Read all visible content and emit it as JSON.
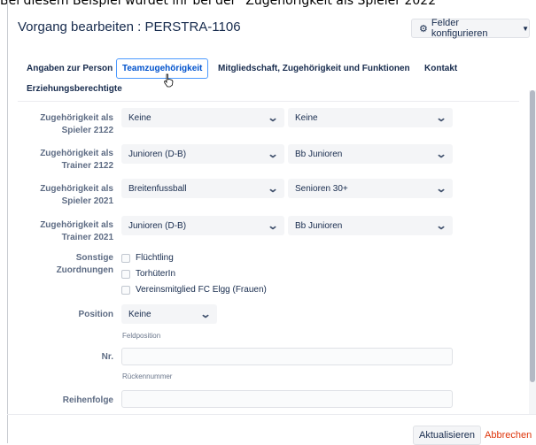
{
  "background_caption": "Bei diesem Beispiel wurdet ihr bei der \"Zugehörigkeit als Spieler 2022",
  "dialog": {
    "title": "Vorgang bearbeiten : PERSTRA-1106",
    "configure_label": "Felder konfigurieren",
    "configure_icon": "gear-icon"
  },
  "tabs": [
    {
      "label": "Angaben zur Person"
    },
    {
      "label": "Teamzugehörigkeit",
      "active": true
    },
    {
      "label": "Mitgliedschaft, Zugehörigkeit und Funktionen"
    },
    {
      "label": "Kontakt"
    },
    {
      "label": "Erziehungsberechtigte"
    }
  ],
  "rows": [
    {
      "label_line1": "Zugehörigkeit als",
      "label_line2": "Spieler 2122",
      "select1": "Keine",
      "select2": "Keine"
    },
    {
      "label_line1": "Zugehörigkeit als",
      "label_line2": "Trainer 2122",
      "select1": "Junioren (D-B)",
      "select2": "Bb Junioren"
    },
    {
      "label_line1": "Zugehörigkeit als",
      "label_line2": "Spieler 2021",
      "select1": "Breitenfussball",
      "select2": "Senioren 30+"
    },
    {
      "label_line1": "Zugehörigkeit als",
      "label_line2": "Trainer 2021",
      "select1": "Junioren (D-B)",
      "select2": "Bb Junioren"
    }
  ],
  "sonstige": {
    "label_line1": "Sonstige",
    "label_line2": "Zuordnungen",
    "options": [
      "Flüchtling",
      "TorhüterIn",
      "Vereinsmitglied FC Elgg (Frauen)"
    ]
  },
  "position": {
    "label": "Position",
    "value": "Keine",
    "help": "Feldposition"
  },
  "nr": {
    "label": "Nr.",
    "value": "",
    "help": "Rückennummer"
  },
  "reihenfolge": {
    "label": "Reihenfolge",
    "value": ""
  },
  "footer": {
    "update_label": "Aktualisieren",
    "cancel_label": "Abbrechen"
  },
  "colors": {
    "accent": "#0052cc",
    "cancel": "#de350b",
    "field_bg": "#f4f5f7"
  }
}
